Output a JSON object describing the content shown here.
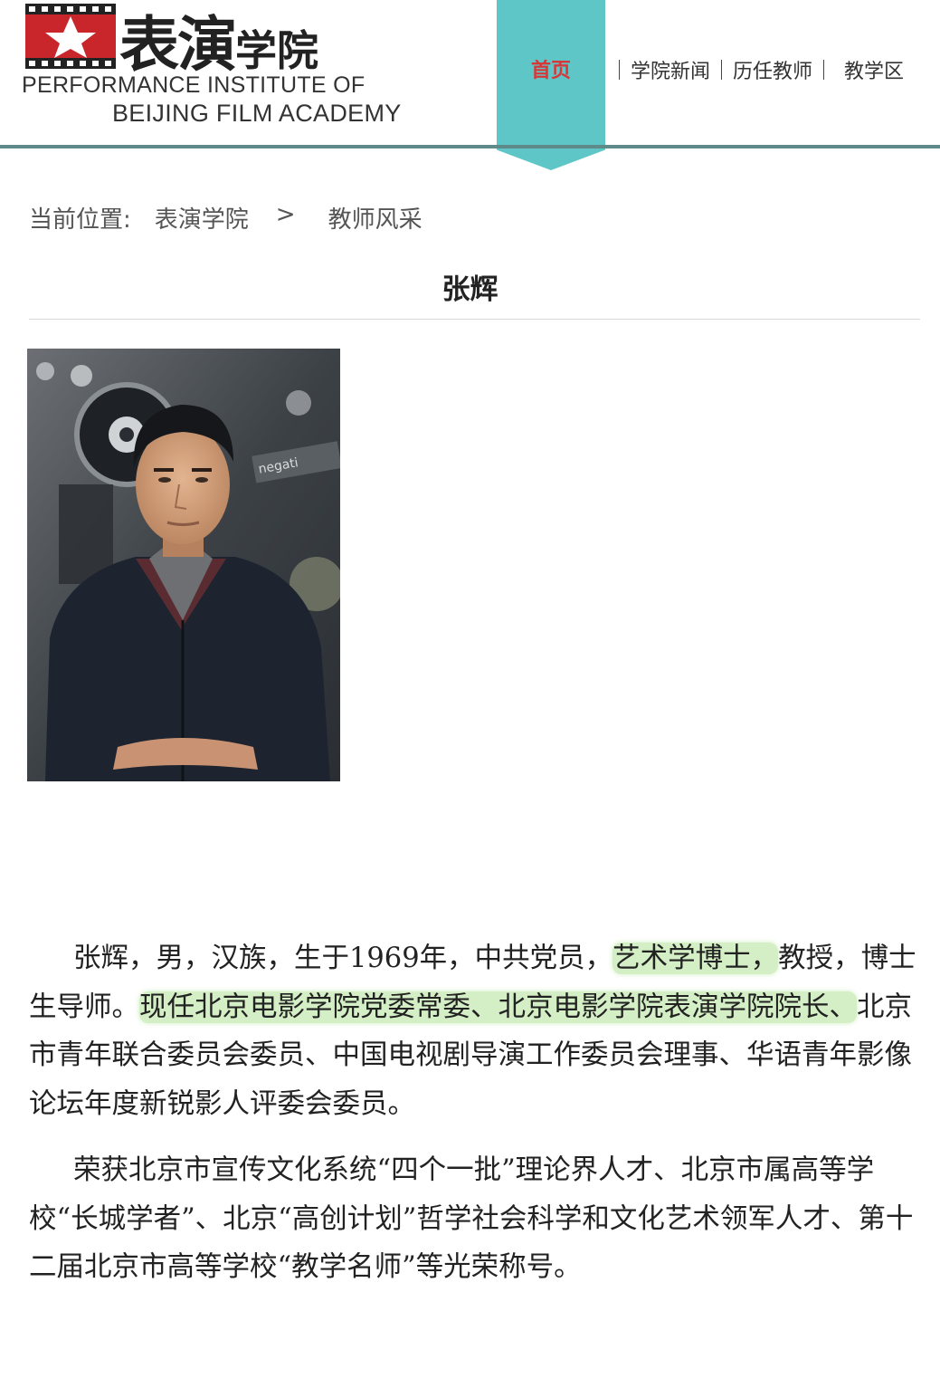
{
  "logo": {
    "cn_big": "表演",
    "cn_small": "学院",
    "en_line1": "PERFORMANCE INSTITUTE OF",
    "en_line2": "BEIJING FILM ACADEMY"
  },
  "nav": {
    "home": "首页",
    "items": [
      "学院新闻",
      "历任教师",
      "教学区"
    ],
    "accent_color": "#5fc6c7",
    "active_text_color": "#d8373a"
  },
  "breadcrumb": {
    "label": "当前位置:",
    "items": [
      "表演学院",
      "教师风采"
    ],
    "separator": ">"
  },
  "page": {
    "title": "张辉"
  },
  "bio": {
    "p1_a": "张辉，男，汉族，生于1969年，中共党员，",
    "p1_hl1": "艺术学博士，",
    "p1_b": "教授，博士生导师。",
    "p1_hl2": "现任北京电影学院党委常委、北京电影学院表演学院院长、",
    "p1_c": "北京市青年联合委员会委员、中国电视剧导演工作委员会理事、华语青年影像论坛年度新锐影人评委会委员。",
    "p2": "荣获北京市宣传文化系统“四个一批”理论界人才、北京市属高等学校“长城学者”、北京“高创计划”哲学社会科学和文化艺术领军人才、第十二届北京市高等学校“教学名师”等光荣称号。"
  }
}
